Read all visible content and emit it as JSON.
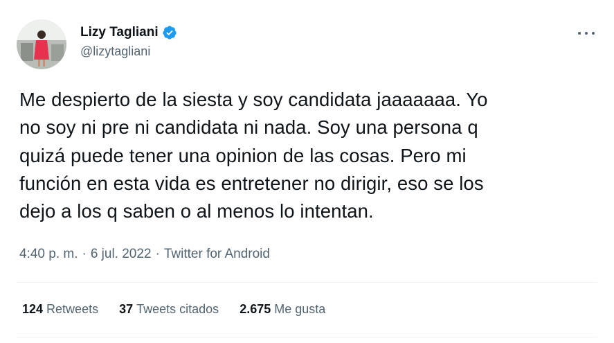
{
  "author": {
    "display_name": "Lizy Tagliani",
    "handle": "@lizytagliani",
    "avatar_icon": "avatar-photo",
    "verified_icon": "verified-badge-icon",
    "verified_color": "#1d9bf0"
  },
  "tweet": {
    "text_lines": [
      "Me despierto de la siesta y soy candidata jaaaaaaa. Yo",
      "no soy ni pre ni candidata ni nada. Soy una persona q",
      "quizá puede tener una opinion de las cosas. Pero mi",
      "función en esta vida es entretener no dirigir, eso se los",
      "dejo a los q saben o al menos lo intentan."
    ],
    "time": "4:40 p. m.",
    "separator": "·",
    "date": "6 jul. 2022",
    "source": "Twitter for Android"
  },
  "stats": {
    "retweets_count": "124",
    "retweets_label": "Retweets",
    "quotes_count": "37",
    "quotes_label": "Tweets citados",
    "likes_count": "2.675",
    "likes_label": "Me gusta"
  },
  "colors": {
    "text_primary": "#0f1419",
    "text_secondary": "#536471",
    "divider": "#eff3f4",
    "accent": "#1d9bf0"
  }
}
